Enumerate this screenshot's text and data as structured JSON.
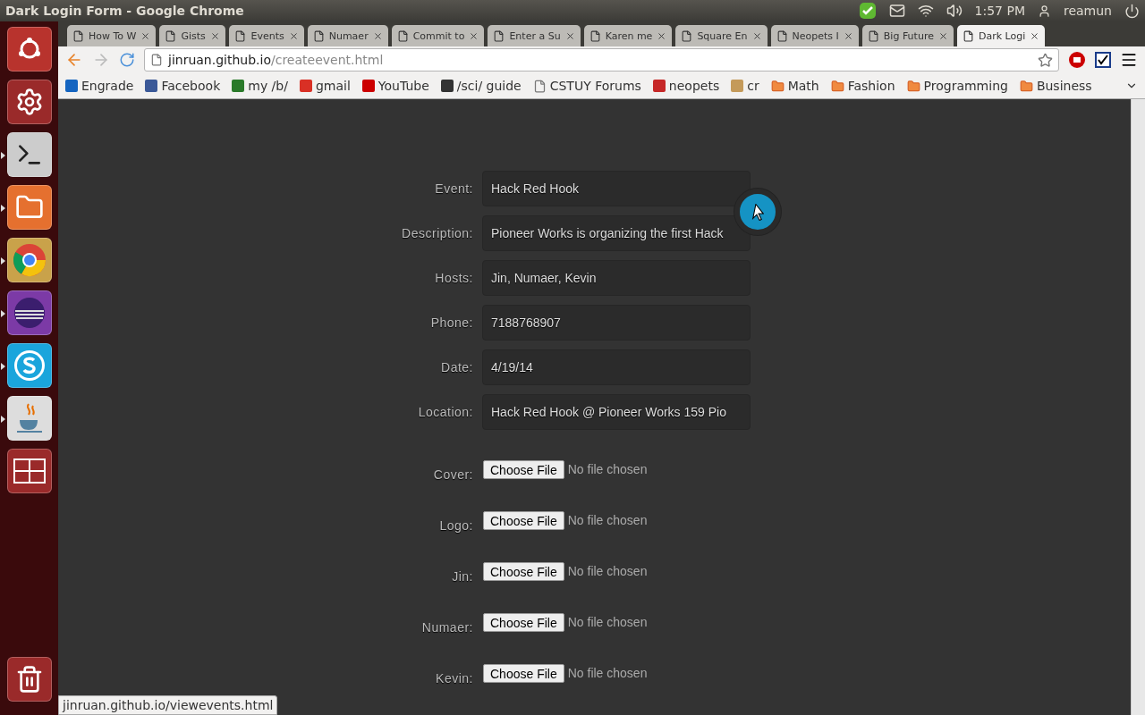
{
  "panel": {
    "title": "Dark Login Form - Google Chrome",
    "time": "1:57 PM",
    "user": "reamun"
  },
  "launcher": [
    {
      "kind": "ubuntu",
      "running": false
    },
    {
      "kind": "settings",
      "running": false
    },
    {
      "kind": "terminal",
      "running": true
    },
    {
      "kind": "files",
      "running": true
    },
    {
      "kind": "browser",
      "running": true
    },
    {
      "kind": "eclipse",
      "running": true
    },
    {
      "kind": "skype",
      "running": true
    },
    {
      "kind": "java",
      "running": true
    },
    {
      "kind": "workspaces",
      "running": false
    },
    {
      "kind": "trash",
      "running": false
    }
  ],
  "tabs": [
    {
      "label": "How To W",
      "selected": false
    },
    {
      "label": "Gists",
      "selected": false
    },
    {
      "label": "Events",
      "selected": false
    },
    {
      "label": "Numaer",
      "selected": false
    },
    {
      "label": "Commit to",
      "selected": false
    },
    {
      "label": "Enter a Su",
      "selected": false
    },
    {
      "label": "Karen me",
      "selected": false
    },
    {
      "label": "Square En",
      "selected": false
    },
    {
      "label": "Neopets I",
      "selected": false
    },
    {
      "label": "Big Future",
      "selected": false
    },
    {
      "label": "Dark Logi",
      "selected": true
    }
  ],
  "address": {
    "host": "jinruan.github.io",
    "path": "/createevent.html"
  },
  "bookmarks": [
    {
      "label": "Engrade",
      "kind": "site"
    },
    {
      "label": "Facebook",
      "kind": "site"
    },
    {
      "label": "my /b/",
      "kind": "site"
    },
    {
      "label": "gmail",
      "kind": "site"
    },
    {
      "label": "YouTube",
      "kind": "site"
    },
    {
      "label": "/sci/ guide",
      "kind": "site"
    },
    {
      "label": "CSTUY Forums",
      "kind": "page"
    },
    {
      "label": "neopets",
      "kind": "site"
    },
    {
      "label": "cr",
      "kind": "site"
    },
    {
      "label": "Math",
      "kind": "folder"
    },
    {
      "label": "Fashion",
      "kind": "folder"
    },
    {
      "label": "Programming",
      "kind": "folder"
    },
    {
      "label": "Business",
      "kind": "folder"
    }
  ],
  "form": {
    "fields": [
      {
        "label": "Event:",
        "value": "Hack Red Hook"
      },
      {
        "label": "Description:",
        "value": "Pioneer Works is organizing the first Hack"
      },
      {
        "label": "Hosts:",
        "value": "Jin, Numaer, Kevin"
      },
      {
        "label": "Phone:",
        "value": "7188768907"
      },
      {
        "label": "Date:",
        "value": "4/19/14"
      },
      {
        "label": "Location:",
        "value": "Hack Red Hook @ Pioneer Works 159 Pio"
      }
    ],
    "files": [
      {
        "label": "Cover:",
        "button": "Choose File",
        "status": "No file chosen"
      },
      {
        "label": "Logo:",
        "button": "Choose File",
        "status": "No file chosen"
      },
      {
        "label": "Jin:",
        "button": "Choose File",
        "status": "No file chosen"
      },
      {
        "label": "Numaer:",
        "button": "Choose File",
        "status": "No file chosen"
      },
      {
        "label": "Kevin:",
        "button": "Choose File",
        "status": "No file chosen"
      }
    ]
  },
  "status_bubble": "jinruan.github.io/viewevents.html"
}
